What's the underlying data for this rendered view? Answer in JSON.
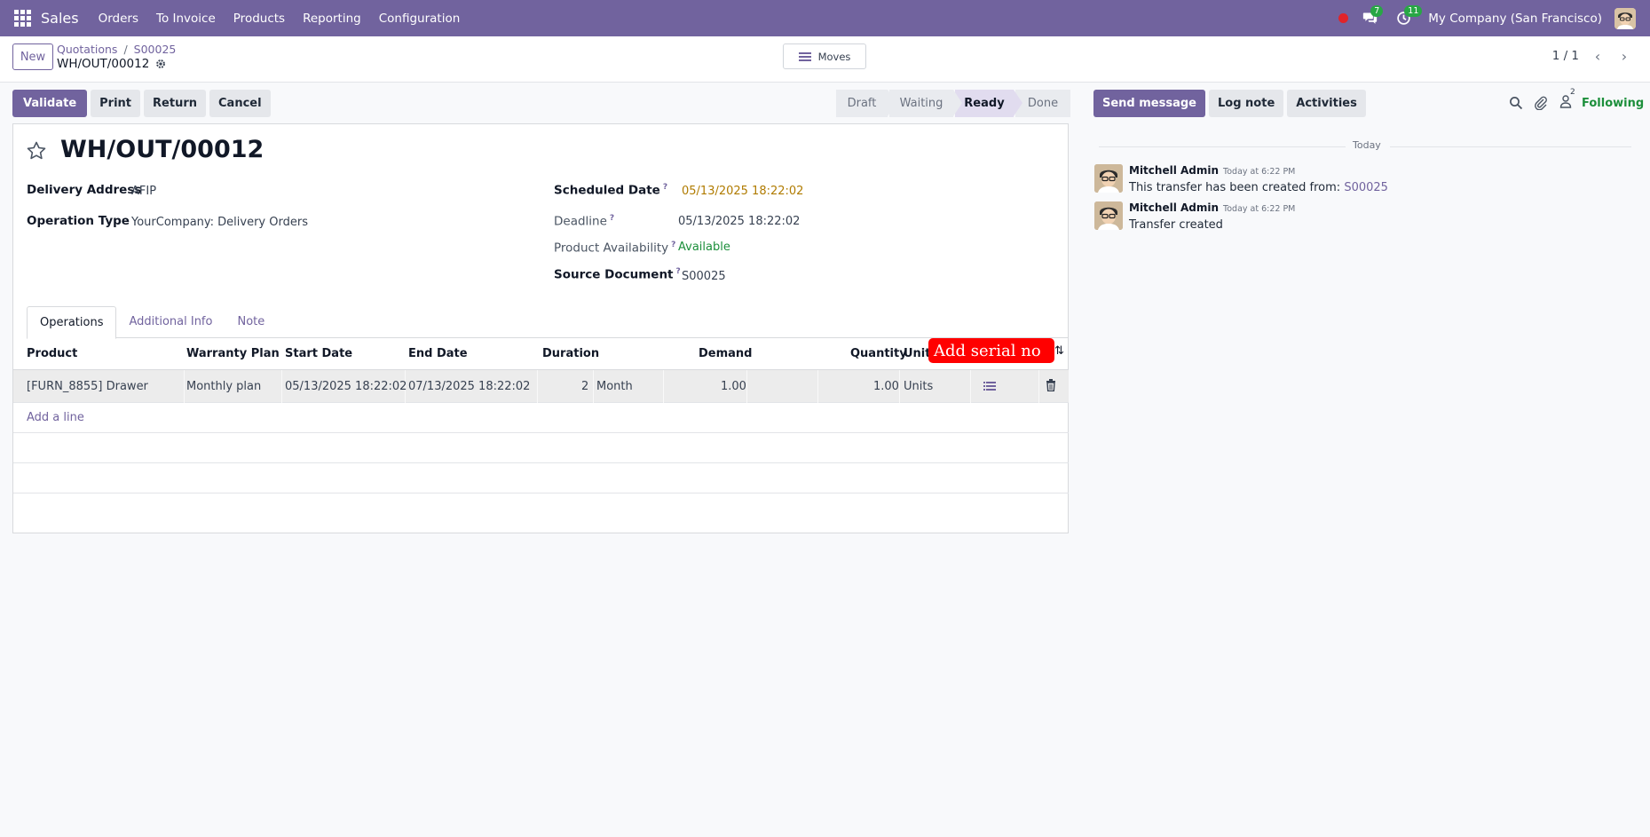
{
  "navbar": {
    "app_name": "Sales",
    "menu": [
      "Orders",
      "To Invoice",
      "Products",
      "Reporting",
      "Configuration"
    ],
    "messages_count": "7",
    "activities_count": "11",
    "company": "My Company (San Francisco)"
  },
  "control_panel": {
    "new_label": "New",
    "breadcrumb_parent": "Quotations",
    "breadcrumb_sep": "/",
    "breadcrumb_order": "S00025",
    "current_record": "WH/OUT/00012",
    "moves_label": "Moves",
    "pager": "1 / 1"
  },
  "actions": {
    "validate": "Validate",
    "print": "Print",
    "return": "Return",
    "cancel": "Cancel"
  },
  "statusbar": {
    "stages": [
      "Draft",
      "Waiting",
      "Ready",
      "Done"
    ],
    "active": "Ready"
  },
  "form": {
    "title": "WH/OUT/00012",
    "delivery_address_label": "Delivery Address",
    "delivery_address": "AFIP",
    "operation_type_label": "Operation Type",
    "operation_type": "YourCompany: Delivery Orders",
    "scheduled_date_label": "Scheduled Date",
    "scheduled_date": "05/13/2025 18:22:02",
    "deadline_label": "Deadline",
    "deadline": "05/13/2025 18:22:02",
    "availability_label": "Product Availability",
    "availability": "Available",
    "source_document_label": "Source Document",
    "source_document": "S00025",
    "help_mark": "?"
  },
  "tabs": [
    "Operations",
    "Additional Info",
    "Note"
  ],
  "operations": {
    "columns": [
      "Product",
      "Warranty Plan",
      "Start Date",
      "End Date",
      "Duration",
      "Demand",
      "Quantity",
      "Unit"
    ],
    "rows": [
      {
        "product": "[FURN_8855] Drawer",
        "warranty_plan": "Monthly plan",
        "start_date": "05/13/2025 18:22:02",
        "end_date": "07/13/2025 18:22:02",
        "duration": "2",
        "duration_unit": "Month",
        "demand": "1.00",
        "quantity": "1.00",
        "unit": "Units"
      }
    ],
    "add_line": "Add a line"
  },
  "annotation": {
    "text": "Add serial no",
    "color": "#ff0000"
  },
  "chatter": {
    "send_message": "Send message",
    "log_note": "Log note",
    "activities": "Activities",
    "followers_count": "2",
    "following": "Following",
    "date_separator": "Today",
    "messages": [
      {
        "author": "Mitchell Admin",
        "time": "Today at 6:22 PM",
        "body": "This transfer has been created from: ",
        "link": "S00025"
      },
      {
        "author": "Mitchell Admin",
        "time": "Today at 6:22 PM",
        "body": "Transfer created",
        "link": ""
      }
    ]
  },
  "colors": {
    "brand": "#71639e",
    "success": "#1c8f3b",
    "warning": "#b07b00"
  }
}
